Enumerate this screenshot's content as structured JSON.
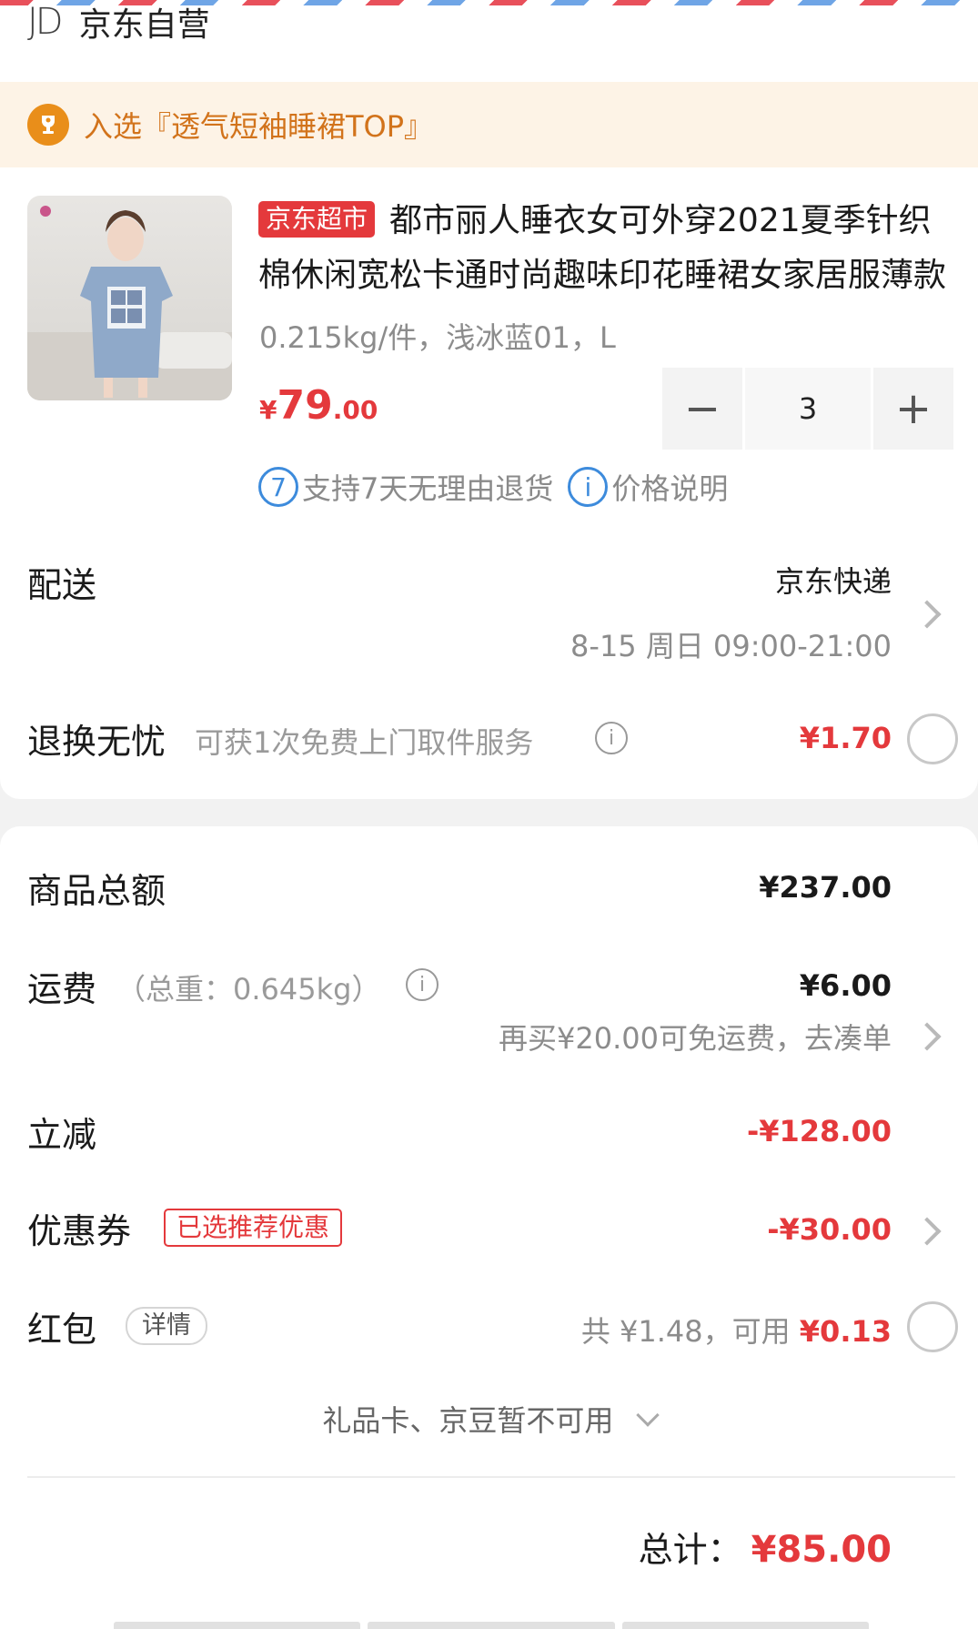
{
  "shop": {
    "logo": "JD",
    "name": "京东自营"
  },
  "banner": {
    "text": "入选『透气短袖睡裙TOP』",
    "icon": "trophy-icon"
  },
  "product": {
    "tag": "京东超市",
    "title": "都市丽人睡衣女可外穿2021夏季针织棉休闲宽松卡通时尚趣味印花睡裙女家居服薄款",
    "spec": "0.215kg/件，浅冰蓝01，L",
    "price": {
      "yen": "¥",
      "int": "79",
      "dec": ".00"
    },
    "quantity": "3",
    "minus": "−",
    "plus": "+",
    "service_badge": "7",
    "service_text": "支持7天无理由退货",
    "info_badge": "i",
    "price_note": "价格说明"
  },
  "delivery": {
    "label": "配送",
    "carrier": "京东快递",
    "time": "8-15 周日 09:00-21:00"
  },
  "return_service": {
    "label": "退换无忧",
    "desc": "可获1次免费上门取件服务",
    "info": "i",
    "price": "¥1.70"
  },
  "summary": {
    "goods_label": "商品总额",
    "goods_value": "¥237.00",
    "shipping_label": "运费",
    "shipping_weight": "（总重：0.645kg）",
    "shipping_info": "i",
    "shipping_value": "¥6.00",
    "shipping_tip": "再买¥20.00可免运费，去凑单",
    "discount_label": "立减",
    "discount_value": "-¥128.00",
    "coupon_label": "优惠券",
    "coupon_tag": "已选推荐优惠",
    "coupon_value": "-¥30.00",
    "redpacket_label": "红包",
    "redpacket_detail": "详情",
    "redpacket_total": "共 ¥1.48，可用 ",
    "redpacket_usable": "¥0.13",
    "giftcard_note": "礼品卡、京豆暂不可用",
    "total_label": "总计：",
    "total_value": "¥85.00"
  },
  "colors": {
    "accent": "#e4393c",
    "banner_text": "#d2731b",
    "link_blue": "#3d8bdc"
  }
}
